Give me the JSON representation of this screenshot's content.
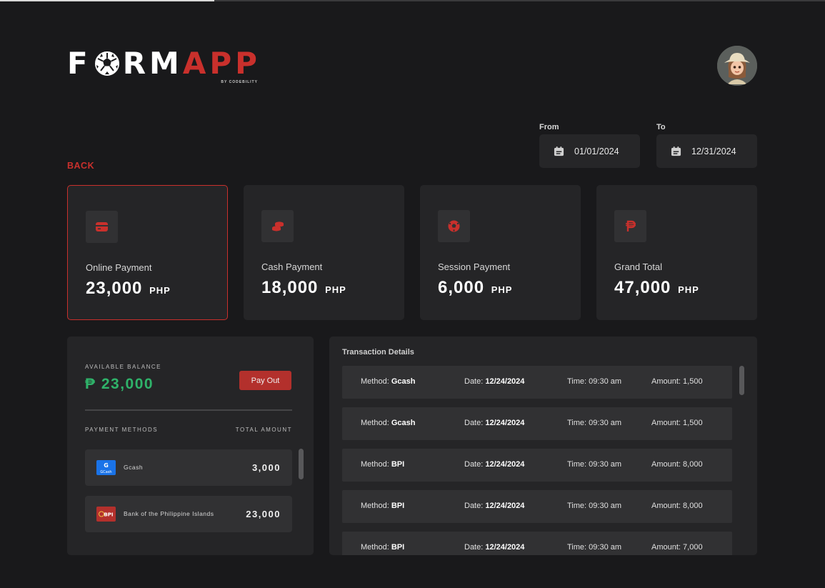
{
  "brand": {
    "name_white": "F",
    "name_white_rest": "RM",
    "name_red": "APP",
    "byline": "BY CODEBILITY",
    "accent": "#c9302c"
  },
  "user": {
    "avatar_icon": "user-avatar"
  },
  "filters": {
    "from_label": "From",
    "from_value": "01/01/2024",
    "to_label": "To",
    "to_value": "12/31/2024"
  },
  "nav": {
    "back_label": "BACK"
  },
  "cards": [
    {
      "label": "Online Payment",
      "amount": "23,000",
      "currency": "PHP",
      "icon": "card-icon",
      "active": true
    },
    {
      "label": "Cash Payment",
      "amount": "18,000",
      "currency": "PHP",
      "icon": "coins-icon",
      "active": false
    },
    {
      "label": "Session Payment",
      "amount": "6,000",
      "currency": "PHP",
      "icon": "ball-icon",
      "active": false
    },
    {
      "label": "Grand Total",
      "amount": "47,000",
      "currency": "PHP",
      "icon": "peso-icon",
      "active": false
    }
  ],
  "balance": {
    "label": "AVAILABLE BALANCE",
    "value": "₱ 23,000",
    "payout_label": "Pay Out",
    "methods_header": "PAYMENT METHODS",
    "total_header": "TOTAL AMOUNT",
    "methods": [
      {
        "name": "Gcash",
        "amount": "3,000",
        "badge": "G\nGCash",
        "color": "#1a73e8"
      },
      {
        "name": "Bank of the Philippine Islands",
        "amount": "23,000",
        "badge": "BPI",
        "color": "#b3302c"
      }
    ]
  },
  "transactions": {
    "title": "Transaction Details",
    "method_label": "Method:",
    "date_label": "Date:",
    "time_label": "Time:",
    "amount_label": "Amount:",
    "rows": [
      {
        "method": "Gcash",
        "date": "12/24/2024",
        "time": "09:30 am",
        "amount": "1,500"
      },
      {
        "method": "Gcash",
        "date": "12/24/2024",
        "time": "09:30 am",
        "amount": "1,500"
      },
      {
        "method": "BPI",
        "date": "12/24/2024",
        "time": "09:30 am",
        "amount": "8,000"
      },
      {
        "method": "BPI",
        "date": "12/24/2024",
        "time": "09:30 am",
        "amount": "8,000"
      },
      {
        "method": "BPI",
        "date": "12/24/2024",
        "time": "09:30 am",
        "amount": "7,000"
      }
    ]
  }
}
